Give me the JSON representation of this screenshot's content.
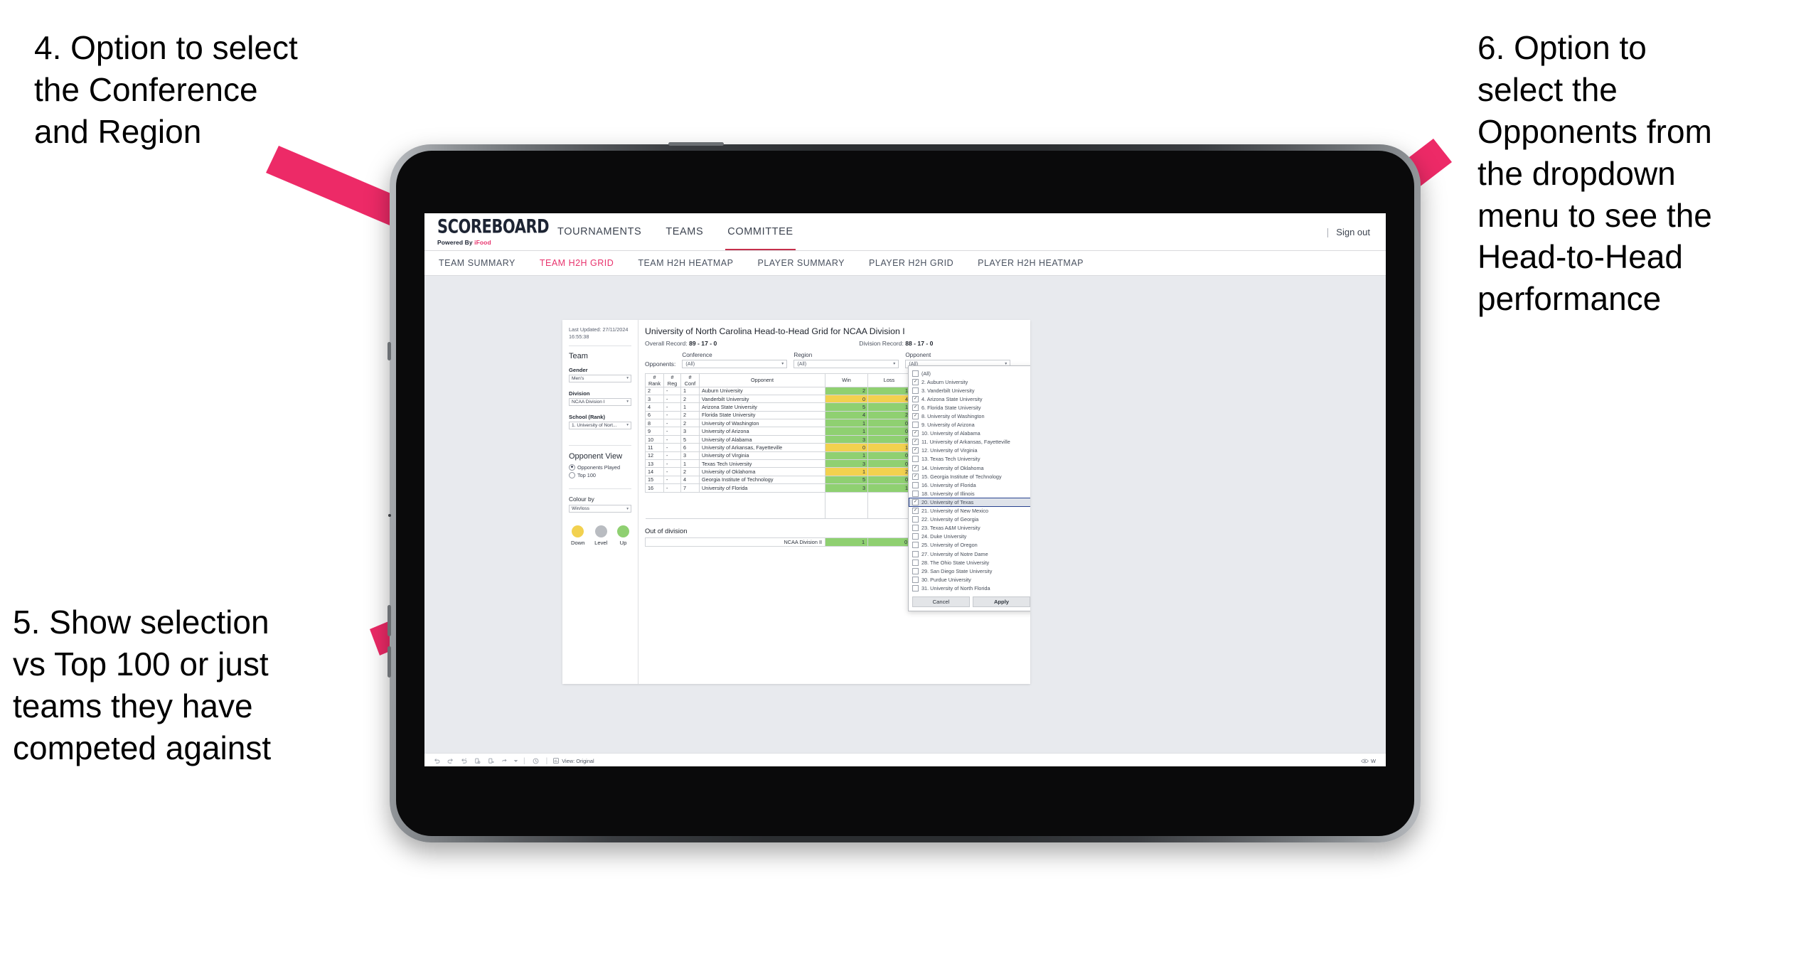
{
  "annotations": [
    {
      "id": "a4",
      "text": "4. Option to select\nthe Conference\nand Region"
    },
    {
      "id": "a5",
      "text": "5. Show selection\nvs Top 100 or just\nteams they have\ncompeted against"
    },
    {
      "id": "a6",
      "text": "6. Option to\nselect the\nOpponents from\nthe dropdown\nmenu to see the\nHead-to-Head\nperformance"
    }
  ],
  "colors": {
    "accent_pink": "#e8336d",
    "arrow_pink": "#ed2a67",
    "nav_underline": "#c6304c",
    "up_green": "#8fd071",
    "down_yellow": "#f2d14f",
    "level_grey": "#b9bcc1",
    "selection_blue": "#27418f"
  },
  "header": {
    "logo": "SCOREBOARD",
    "logo_sub_prefix": "Powered By ",
    "logo_sub_brand": "iFood",
    "nav": [
      {
        "label": "TOURNAMENTS",
        "active": false
      },
      {
        "label": "TEAMS",
        "active": false
      },
      {
        "label": "COMMITTEE",
        "active": true
      }
    ],
    "separator": "|",
    "sign_out": "Sign out"
  },
  "subnav": [
    {
      "label": "TEAM SUMMARY",
      "active": false
    },
    {
      "label": "TEAM H2H GRID",
      "active": true
    },
    {
      "label": "TEAM H2H HEATMAP",
      "active": false
    },
    {
      "label": "PLAYER SUMMARY",
      "active": false
    },
    {
      "label": "PLAYER H2H GRID",
      "active": false
    },
    {
      "label": "PLAYER H2H HEATMAP",
      "active": false
    }
  ],
  "filters": {
    "last_updated": "Last Updated: 27/11/2024\n16:55:38",
    "team_heading": "Team",
    "gender_label": "Gender",
    "gender_value": "Men's",
    "division_label": "Division",
    "division_value": "NCAA Division I",
    "school_label": "School (Rank)",
    "school_value": "1. University of Nort...",
    "opponent_view_heading": "Opponent View",
    "opponent_view_options": [
      {
        "label": "Opponents Played",
        "selected": true
      },
      {
        "label": "Top 100",
        "selected": false
      }
    ],
    "colour_by_label": "Colour by",
    "colour_by_value": "Win/loss",
    "legend": [
      {
        "label": "Down",
        "color": "#f2d14f"
      },
      {
        "label": "Level",
        "color": "#b9bcc1"
      },
      {
        "label": "Up",
        "color": "#8fd071"
      }
    ]
  },
  "viz": {
    "title": "University of North Carolina Head-to-Head Grid for NCAA Division I",
    "overall_record_label": "Overall Record: ",
    "overall_record_value": "89 - 17 - 0",
    "division_record_label": "Division Record: ",
    "division_record_value": "88 - 17 - 0",
    "opponents_label": "Opponents:",
    "filter_bar": [
      {
        "label": "Conference",
        "value": "(All)"
      },
      {
        "label": "Region",
        "value": "(All)"
      },
      {
        "label": "Opponent",
        "value": "(All)"
      }
    ],
    "out_of_division_title": "Out of division",
    "out_of_division_row": {
      "label": "NCAA Division II",
      "win": "1",
      "loss": "0",
      "state": "up"
    }
  },
  "chart_data": {
    "type": "table",
    "title": "University of North Carolina Head-to-Head Grid for NCAA Division I",
    "columns": [
      "# Rank",
      "# Reg",
      "# Conf",
      "Opponent",
      "Win",
      "Loss"
    ],
    "column_header_lines": [
      [
        "#",
        "Rank"
      ],
      [
        "#",
        "Reg"
      ],
      [
        "#",
        "Conf"
      ],
      [
        "Opponent"
      ],
      [
        "Win"
      ],
      [
        "Loss"
      ]
    ],
    "color_key": {
      "up": "green (more wins than losses)",
      "down": "yellow (more losses than wins)",
      "level": "grey (equal)"
    },
    "rows": [
      {
        "rank": "2",
        "reg": "-",
        "conf": "1",
        "opponent": "Auburn University",
        "win": "2",
        "loss": "1",
        "state": "up"
      },
      {
        "rank": "3",
        "reg": "-",
        "conf": "2",
        "opponent": "Vanderbilt University",
        "win": "0",
        "loss": "4",
        "state": "down"
      },
      {
        "rank": "4",
        "reg": "-",
        "conf": "1",
        "opponent": "Arizona State University",
        "win": "5",
        "loss": "1",
        "state": "up"
      },
      {
        "rank": "6",
        "reg": "-",
        "conf": "2",
        "opponent": "Florida State University",
        "win": "4",
        "loss": "2",
        "state": "up"
      },
      {
        "rank": "8",
        "reg": "-",
        "conf": "2",
        "opponent": "University of Washington",
        "win": "1",
        "loss": "0",
        "state": "up"
      },
      {
        "rank": "9",
        "reg": "-",
        "conf": "3",
        "opponent": "University of Arizona",
        "win": "1",
        "loss": "0",
        "state": "up"
      },
      {
        "rank": "10",
        "reg": "-",
        "conf": "5",
        "opponent": "University of Alabama",
        "win": "3",
        "loss": "0",
        "state": "up"
      },
      {
        "rank": "11",
        "reg": "-",
        "conf": "6",
        "opponent": "University of Arkansas, Fayetteville",
        "win": "0",
        "loss": "1",
        "state": "down"
      },
      {
        "rank": "12",
        "reg": "-",
        "conf": "3",
        "opponent": "University of Virginia",
        "win": "1",
        "loss": "0",
        "state": "up"
      },
      {
        "rank": "13",
        "reg": "-",
        "conf": "1",
        "opponent": "Texas Tech University",
        "win": "3",
        "loss": "0",
        "state": "up"
      },
      {
        "rank": "14",
        "reg": "-",
        "conf": "2",
        "opponent": "University of Oklahoma",
        "win": "1",
        "loss": "2",
        "state": "down"
      },
      {
        "rank": "15",
        "reg": "-",
        "conf": "4",
        "opponent": "Georgia Institute of Technology",
        "win": "5",
        "loss": "0",
        "state": "up"
      },
      {
        "rank": "16",
        "reg": "-",
        "conf": "7",
        "opponent": "University of Florida",
        "win": "3",
        "loss": "1",
        "state": "up"
      }
    ]
  },
  "opponent_dropdown": {
    "items": [
      {
        "label": "(All)",
        "checked": false,
        "selected": false
      },
      {
        "label": "2. Auburn University",
        "checked": true,
        "selected": false
      },
      {
        "label": "3. Vanderbilt University",
        "checked": false,
        "selected": false
      },
      {
        "label": "4. Arizona State University",
        "checked": true,
        "selected": false
      },
      {
        "label": "6. Florida State University",
        "checked": true,
        "selected": false
      },
      {
        "label": "8. University of Washington",
        "checked": true,
        "selected": false
      },
      {
        "label": "9. University of Arizona",
        "checked": false,
        "selected": false
      },
      {
        "label": "10. University of Alabama",
        "checked": true,
        "selected": false
      },
      {
        "label": "11. University of Arkansas, Fayetteville",
        "checked": true,
        "selected": false
      },
      {
        "label": "12. University of Virginia",
        "checked": true,
        "selected": false
      },
      {
        "label": "13. Texas Tech University",
        "checked": false,
        "selected": false
      },
      {
        "label": "14. University of Oklahoma",
        "checked": true,
        "selected": false
      },
      {
        "label": "15. Georgia Institute of Technology",
        "checked": true,
        "selected": false
      },
      {
        "label": "16. University of Florida",
        "checked": false,
        "selected": false
      },
      {
        "label": "18. University of Illinois",
        "checked": false,
        "selected": false
      },
      {
        "label": "20. University of Texas",
        "checked": true,
        "selected": true
      },
      {
        "label": "21. University of New Mexico",
        "checked": true,
        "selected": false
      },
      {
        "label": "22. University of Georgia",
        "checked": false,
        "selected": false
      },
      {
        "label": "23. Texas A&M University",
        "checked": false,
        "selected": false
      },
      {
        "label": "24. Duke University",
        "checked": false,
        "selected": false
      },
      {
        "label": "25. University of Oregon",
        "checked": false,
        "selected": false
      },
      {
        "label": "27. University of Notre Dame",
        "checked": false,
        "selected": false
      },
      {
        "label": "28. The Ohio State University",
        "checked": false,
        "selected": false
      },
      {
        "label": "29. San Diego State University",
        "checked": false,
        "selected": false
      },
      {
        "label": "30. Purdue University",
        "checked": false,
        "selected": false
      },
      {
        "label": "31. University of North Florida",
        "checked": false,
        "selected": false
      }
    ],
    "cancel_label": "Cancel",
    "apply_label": "Apply"
  },
  "toolbar": {
    "icons": [
      "undo-icon",
      "redo-icon",
      "revert-icon",
      "refresh-icon",
      "pause-icon",
      "share-icon",
      "chevron-down-icon",
      "clock-icon"
    ],
    "view_label": "View: Original",
    "right_label": "W"
  }
}
